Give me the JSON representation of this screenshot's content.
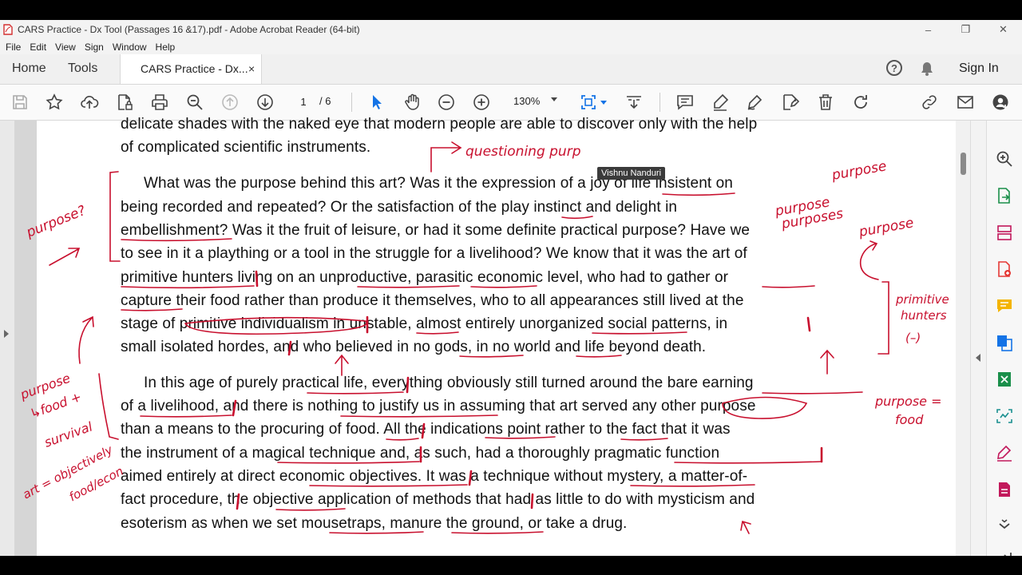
{
  "window": {
    "title": "CARS Practice - Dx Tool (Passages 16 &17).pdf - Adobe Acrobat Reader (64-bit)",
    "minimize_glyph": "–",
    "restore_glyph": "❐",
    "close_glyph": "✕"
  },
  "menu": {
    "items": [
      "File",
      "Edit",
      "View",
      "Sign",
      "Window",
      "Help"
    ]
  },
  "tabs": {
    "home": "Home",
    "tools": "Tools",
    "document": "CARS Practice - Dx...",
    "close_glyph": "×",
    "help_glyph": "?",
    "signin": "Sign In"
  },
  "toolbar": {
    "page_current": "1",
    "page_total": "/ 6",
    "zoom": "130%"
  },
  "tooltip": "Vishnu Nanduri",
  "document": {
    "lines": [
      "delicate shades with the naked eye that modern people are able to discover only with the help",
      "of complicated scientific instruments.",
      "What was the purpose behind this art? Was it the expression of a joy of life insistent on",
      "being recorded and repeated? Or the satisfaction of the play instinct and delight in",
      "embellishment? Was it the fruit of leisure, or had it some definite practical purpose? Have we",
      "to see in it a plaything or a tool in the struggle for a livelihood? We know that it was the art of",
      "primitive hunters living on an unproductive, parasitic economic level, who had to gather or",
      "capture their food rather than produce it themselves, who to all appearances still lived at the",
      "stage of primitive individualism in unstable, almost entirely unorganized social patterns, in",
      "small isolated hordes, and who believed in no gods, in no world and life beyond death.",
      "In this age of purely practical life, everything obviously still turned around the bare earning",
      "of a livelihood, and there is nothing to justify us in assuming that art served any other purpose",
      "than a means to the procuring of food. All the indications point rather to the fact that it was",
      "the instrument of a magical technique and, as such, had a thoroughly pragmatic function",
      "aimed entirely at direct economic objectives. It was a technique without mystery, a matter-of-",
      "fact procedure, the objective application of methods that had as little to do with mysticism and",
      "esoterism as when we set mousetraps, manure the ground, or take a drug."
    ]
  },
  "annotations": {
    "questioning": "questioning purp",
    "purpose_q": "purpose?",
    "purpose_1": "purpose",
    "purpose_2": "purpose",
    "purposes": "purposes",
    "purpose_3": "purpose",
    "primitive": "primitive",
    "hunters": "hunters",
    "minus": "(–)",
    "purpose_food_1": "purpose =",
    "purpose_food_2": "food",
    "left_1": "purpose",
    "left_2": "↳food +",
    "left_3": "survival",
    "left_4": "art = objectively",
    "left_5": "food/econ"
  }
}
